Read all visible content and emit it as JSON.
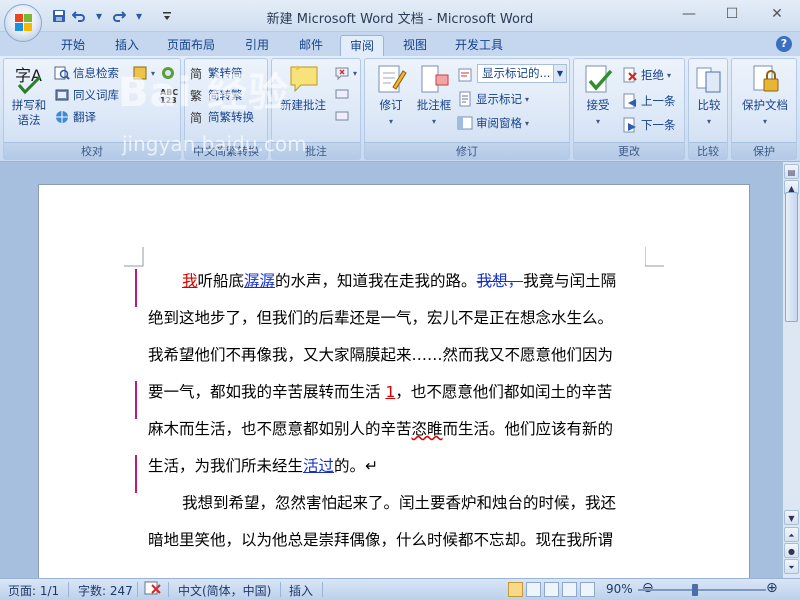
{
  "window": {
    "title": "新建 Microsoft Word 文档 - Microsoft Word",
    "controls": [
      "minimize-icon",
      "maximize-icon",
      "close-icon"
    ]
  },
  "quick_access": [
    "save-icon",
    "undo-icon",
    "redo-icon",
    "customize-icon"
  ],
  "tabs": [
    {
      "label": "开始"
    },
    {
      "label": "插入"
    },
    {
      "label": "页面布局"
    },
    {
      "label": "引用"
    },
    {
      "label": "邮件"
    },
    {
      "label": "审阅",
      "active": true
    },
    {
      "label": "视图"
    },
    {
      "label": "开发工具"
    }
  ],
  "ribbon": {
    "proofing": {
      "group_label": "校对",
      "spelling": "拼写和\n语法",
      "research": "信息检索",
      "thesaurus": "同义词库",
      "translate": "翻译",
      "abc_label": "ABC\n123"
    },
    "chinese": {
      "group_label": "中文简繁转换",
      "to_simplified": "繁转简",
      "to_traditional": "简转繁",
      "convert": "简繁转换"
    },
    "comments": {
      "group_label": "批注",
      "new_comment": "新建批注"
    },
    "tracking": {
      "group_label": "修订",
      "track_changes": "修订",
      "balloons": "批注框",
      "display_combo": "显示标记的...",
      "show_markup": "显示标记",
      "reviewing_pane": "审阅窗格"
    },
    "changes": {
      "group_label": "更改",
      "accept": "接受",
      "reject": "拒绝",
      "previous": "上一条",
      "next": "下一条"
    },
    "compare": {
      "group_label": "比较",
      "compare": "比较"
    },
    "protect": {
      "group_label": "保护",
      "protect_doc": "保护文档"
    }
  },
  "watermark": {
    "brand": "Bai 经验",
    "url": "jingyan.baidu.com"
  },
  "document": {
    "lines": [
      {
        "segments": [
          {
            "t": "我",
            "s": "red"
          },
          {
            "t": "听船底"
          },
          {
            "t": "潺潺",
            "s": "blue"
          },
          {
            "t": "的水声，知道我在走我的路。"
          },
          {
            "t": "我想，",
            "s": "blue-strike"
          },
          {
            "t": "我竟与闰土隔"
          }
        ]
      },
      {
        "segments": [
          {
            "t": "绝到这地步了，但我们的后辈还是一气，宏儿不是正在想念水生么。"
          }
        ]
      },
      {
        "segments": [
          {
            "t": "我希望他们不再像我，又大家隔膜起来……然而我又不愿意他们因为"
          }
        ]
      },
      {
        "segments": [
          {
            "t": "要一气，都如我的辛苦展转而生活 "
          },
          {
            "t": "1",
            "s": "red"
          },
          {
            "t": "，也不愿意他们都如闰土的辛苦"
          }
        ]
      },
      {
        "segments": [
          {
            "t": "麻木而生活，也不愿意都如别人的辛苦"
          },
          {
            "t": "恣睢",
            "s": "wavy"
          },
          {
            "t": "而生活。他们应该有新的"
          }
        ]
      },
      {
        "segments": [
          {
            "t": "生活，为我们所未经生"
          },
          {
            "t": "活过",
            "s": "blue"
          },
          {
            "t": "的。↵"
          }
        ]
      },
      {
        "segments": [
          {
            "t": "我想到希望，忽然害怕起来了。闰土要香炉和烛台的时候，我还"
          }
        ]
      },
      {
        "segments": [
          {
            "t": "暗地里笑他，以为他总是崇拜偶像，什么时候都不忘却。现在我所谓"
          }
        ]
      }
    ]
  },
  "statusbar": {
    "page": "页面: 1/1",
    "words": "字数: 247",
    "language": "中文(简体，中国)",
    "mode": "插入",
    "zoom": "90%",
    "zoom_level_percent": 90
  }
}
